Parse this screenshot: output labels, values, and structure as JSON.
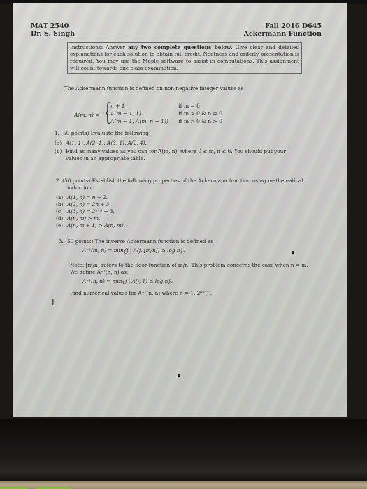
{
  "header": {
    "course": "MAT 2540",
    "instructor": "Dr. S. Singh",
    "term": "Fall 2016 D645",
    "title": "Ackermann Function"
  },
  "instructions": {
    "prefix": "Instructions: Answer ",
    "bold": "any two complete questions below",
    "suffix": ". Give clear and detailed explanations for each solution to obtain full credit. Neatness and orderly presentation is required. You may use the Maple software to assist in computations. This assignment will count towards one class examination."
  },
  "definition": {
    "intro": "The Ackermann function is defined on non negative integer values as",
    "lhs": "A(m, n) =",
    "cases": [
      {
        "expr": "n + 1",
        "cond": "if m = 0"
      },
      {
        "expr": "A(m − 1, 1)",
        "cond": "if m > 0 & n = 0"
      },
      {
        "expr": "A(m − 1, A(m, n − 1))",
        "cond": "if m > 0 & n > 0"
      }
    ]
  },
  "questions": [
    {
      "head": "1. (50 points) Evaluate the following:",
      "items": [
        {
          "label": "(a)",
          "text": "A(1, 1), A(2, 1), A(3, 1), A(2, 4)."
        },
        {
          "label": "(b)",
          "text": "Find as many values as you can for A(m, n), where 0 ≤ m, n ≤ 6. You should put your",
          "cont": "values in an appropriate table."
        }
      ]
    },
    {
      "head": "2. (50 points) Establish the following properties of the Ackermann function using mathematical",
      "head_cont": "induction.",
      "items": [
        {
          "label": "(a)",
          "text": "A(1, n) = n + 2."
        },
        {
          "label": "(b)",
          "text": "A(2, n) = 2n + 3."
        },
        {
          "label": "(c)",
          "text": "A(3, n) = 2ⁿ⁺³ − 3."
        },
        {
          "label": "(d)",
          "text": "A(n, m) > m."
        },
        {
          "label": "(e)",
          "text": "A(n, m + 1) > A(n, m)."
        }
      ]
    },
    {
      "head": "3. (50 points) The inverse Ackermann function is defined as",
      "formula1": "A⁻¹(m, n) = min{j | A(j, ⌊m/n⌋) ≥ log n}.",
      "note1": "Note: ⌊m/n⌋ refers to the floor function of m/n. This problem concerns the case when n = m.",
      "note2": "We define A⁻¹(n, n) as:",
      "formula2": "A⁻¹(n, n) = min{j | A(j, 1) ≥ log n}.",
      "task": "Find numerical values for A⁻¹(n, n) where n = 1..2⁶⁵⁵³³."
    }
  ]
}
